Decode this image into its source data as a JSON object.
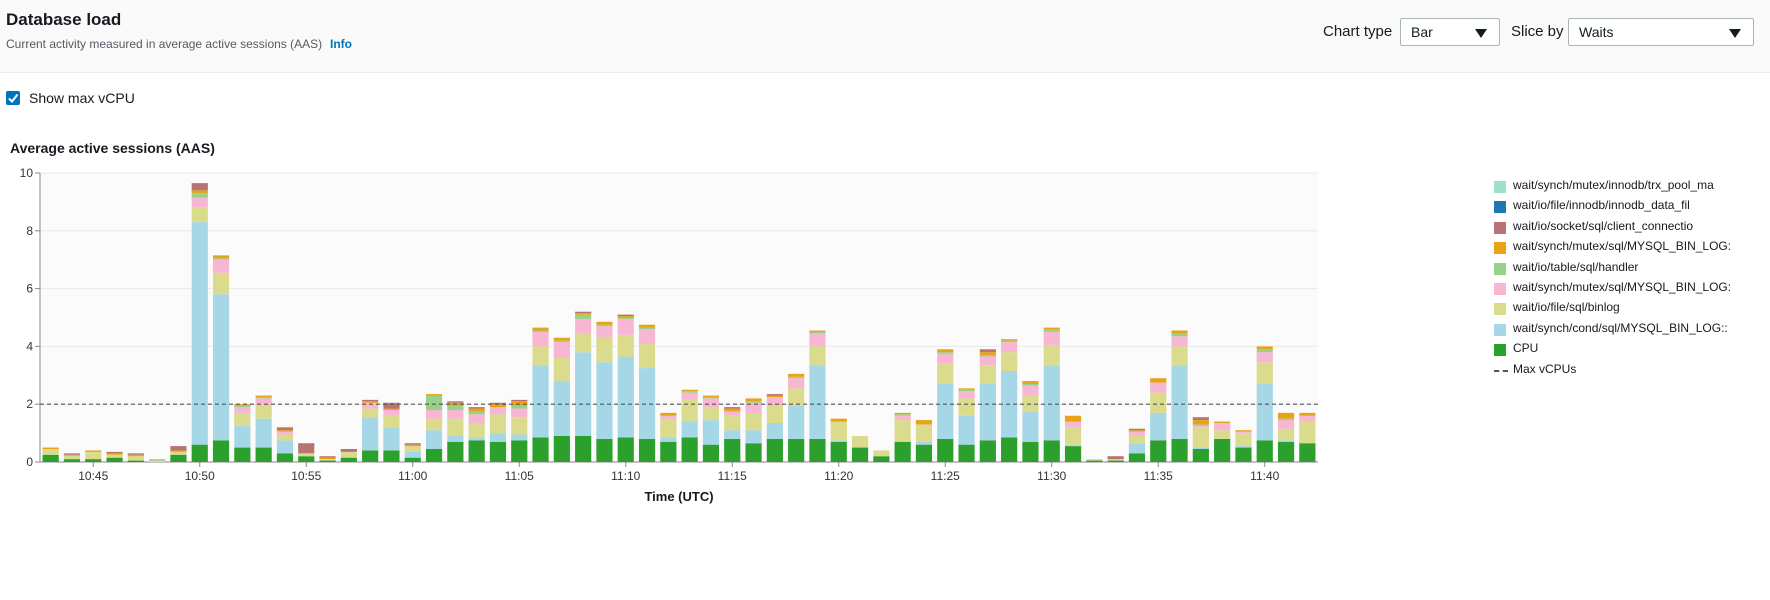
{
  "header": {
    "title": "Database load",
    "subtitle": "Current activity measured in average active sessions (AAS)",
    "info_link": "Info",
    "chart_type_label": "Chart type",
    "chart_type_value": "Bar",
    "slice_by_label": "Slice by",
    "slice_by_value": "Waits"
  },
  "controls": {
    "show_max_vcpu_label": "Show max vCPU",
    "show_max_vcpu_checked": true
  },
  "colors": {
    "accent": "#0073bb",
    "max_line": "#555555"
  },
  "chart_data": {
    "type": "bar",
    "stacked": true,
    "title": "Average active sessions (AAS)",
    "xlabel": "Time (UTC)",
    "ylabel": "",
    "ylim": [
      0,
      10
    ],
    "yticks": [
      0,
      2,
      4,
      6,
      8,
      10
    ],
    "grid": true,
    "legend_position": "right",
    "x_tick_labels": [
      "10:45",
      "10:50",
      "10:55",
      "11:00",
      "11:05",
      "11:10",
      "11:15",
      "11:20",
      "11:25",
      "11:30",
      "11:35",
      "11:40"
    ],
    "x_tick_bar_index": [
      2,
      7,
      12,
      17,
      22,
      27,
      32,
      37,
      42,
      47,
      52,
      57
    ],
    "max_vcpu": 2,
    "series": [
      {
        "name": "CPU",
        "color": "#2ca02c",
        "values": [
          0.25,
          0.1,
          0.1,
          0.15,
          0.05,
          0,
          0.25,
          0.6,
          0.75,
          0.5,
          0.5,
          0.3,
          0.2,
          0.05,
          0.15,
          0.4,
          0.4,
          0.15,
          0.45,
          0.7,
          0.75,
          0.7,
          0.75,
          0.85,
          0.9,
          0.9,
          0.8,
          0.85,
          0.8,
          0.7,
          0.85,
          0.6,
          0.8,
          0.65,
          0.8,
          0.8,
          0.8,
          0.7,
          0.5,
          0.2,
          0.7,
          0.6,
          0.8,
          0.6,
          0.75,
          0.85,
          0.7,
          0.75,
          0.55,
          0.05,
          0.05,
          0.3,
          0.75,
          0.8,
          0.45,
          0.8,
          0.5,
          0.75,
          0.7,
          0.65
        ]
      },
      {
        "name": "wait/synch/cond/sql/MYSQL_BIN_LOG::",
        "color": "#a6d7e6",
        "values": [
          0,
          0,
          0,
          0,
          0,
          0,
          0,
          7.7,
          5.05,
          0.75,
          1.0,
          0.45,
          0,
          0,
          0,
          1.15,
          0.8,
          0.2,
          0.65,
          0.2,
          0.1,
          0.3,
          0.2,
          2.5,
          1.9,
          2.9,
          2.65,
          2.8,
          2.45,
          0.15,
          0.55,
          0.85,
          0.3,
          0.45,
          0.55,
          1.15,
          2.55,
          0.05,
          0,
          0,
          0,
          0.1,
          1.9,
          1.0,
          1.95,
          2.3,
          1.05,
          2.6,
          0.05,
          0,
          0,
          0.35,
          0.95,
          2.55,
          0.05,
          0,
          0.05,
          1.95,
          0.05,
          0
        ]
      },
      {
        "name": "wait/io/file/sql/binlog",
        "color": "#dbdb8d",
        "values": [
          0.2,
          0.1,
          0.25,
          0.1,
          0.15,
          0.05,
          0.1,
          0.5,
          0.75,
          0.45,
          0.45,
          0.2,
          0.1,
          0.05,
          0.2,
          0.3,
          0.4,
          0.2,
          0.4,
          0.6,
          0.5,
          0.65,
          0.6,
          0.65,
          0.8,
          0.65,
          0.85,
          0.75,
          0.85,
          0.65,
          0.75,
          0.45,
          0.5,
          0.6,
          0.6,
          0.6,
          0.65,
          0.65,
          0.4,
          0.2,
          0.75,
          0.6,
          0.7,
          0.6,
          0.65,
          0.65,
          0.55,
          0.7,
          0.6,
          0.05,
          0.05,
          0.25,
          0.7,
          0.65,
          0.7,
          0.3,
          0.45,
          0.75,
          0.4,
          0.75
        ]
      },
      {
        "name": "wait/synch/mutex/sql/MYSQL_BIN_LOG:",
        "color": "#f7b6d2",
        "values": [
          0,
          0,
          0,
          0,
          0,
          0,
          0,
          0.35,
          0.45,
          0.2,
          0.25,
          0.1,
          0,
          0,
          0,
          0.2,
          0.2,
          0,
          0.3,
          0.3,
          0.3,
          0.25,
          0.3,
          0.5,
          0.55,
          0.5,
          0.4,
          0.55,
          0.5,
          0.1,
          0.25,
          0.3,
          0.15,
          0.35,
          0.3,
          0.35,
          0.45,
          0,
          0,
          0,
          0.15,
          0,
          0.35,
          0.25,
          0.3,
          0.35,
          0.35,
          0.45,
          0.2,
          0,
          0,
          0.15,
          0.35,
          0.35,
          0.05,
          0.25,
          0.05,
          0.35,
          0.3,
          0.2
        ]
      },
      {
        "name": "wait/io/table/sql/handler",
        "color": "#98d18a",
        "values": [
          0,
          0.05,
          0,
          0,
          0,
          0.05,
          0,
          0.15,
          0.05,
          0.05,
          0.05,
          0,
          0,
          0,
          0,
          0,
          0,
          0,
          0.5,
          0.15,
          0.1,
          0,
          0.1,
          0.05,
          0.05,
          0.15,
          0.05,
          0.05,
          0.05,
          0,
          0.05,
          0.05,
          0,
          0.05,
          0,
          0.05,
          0.05,
          0,
          0,
          0,
          0.05,
          0,
          0.05,
          0.05,
          0.05,
          0.05,
          0.05,
          0.1,
          0,
          0,
          0,
          0,
          0,
          0.1,
          0.05,
          0,
          0,
          0.1,
          0.05,
          0
        ]
      },
      {
        "name": "wait/synch/mutex/sql/MYSQL_BIN_LOG:",
        "color": "#e8a317",
        "values": [
          0.05,
          0,
          0.05,
          0.05,
          0.05,
          0,
          0.05,
          0.1,
          0.1,
          0.05,
          0.05,
          0.05,
          0,
          0.05,
          0,
          0.05,
          0.05,
          0.05,
          0.05,
          0.1,
          0.1,
          0.1,
          0.15,
          0.1,
          0.1,
          0.05,
          0.1,
          0.05,
          0.1,
          0.1,
          0.05,
          0.05,
          0.1,
          0.1,
          0.05,
          0.1,
          0.05,
          0.1,
          0,
          0,
          0.05,
          0.15,
          0.1,
          0.05,
          0.1,
          0.05,
          0.1,
          0.05,
          0.2,
          0,
          0,
          0.05,
          0.15,
          0.1,
          0.15,
          0.05,
          0.05,
          0.1,
          0.2,
          0.1
        ]
      },
      {
        "name": "wait/io/socket/sql/client_connectio",
        "color": "#b87373",
        "values": [
          0,
          0.05,
          0,
          0.05,
          0.05,
          0,
          0.15,
          0.25,
          0,
          0,
          0,
          0.1,
          0.35,
          0.05,
          0.1,
          0.05,
          0.2,
          0.05,
          0,
          0.05,
          0.05,
          0.05,
          0.05,
          0,
          0,
          0.05,
          0,
          0.05,
          0,
          0,
          0,
          0,
          0.05,
          0,
          0.05,
          0,
          0,
          0,
          0,
          0,
          0,
          0,
          0,
          0,
          0.1,
          0,
          0,
          0,
          0,
          0,
          0.1,
          0.05,
          0,
          0,
          0.1,
          0,
          0,
          0,
          0,
          0
        ]
      },
      {
        "name": "wait/io/file/innodb/innodb_data_fil",
        "color": "#1f77b4",
        "values": [
          0,
          0,
          0,
          0,
          0,
          0,
          0,
          0,
          0,
          0,
          0,
          0,
          0,
          0,
          0,
          0,
          0,
          0,
          0,
          0,
          0,
          0,
          0,
          0,
          0,
          0,
          0,
          0,
          0,
          0,
          0,
          0,
          0,
          0,
          0,
          0,
          0,
          0,
          0,
          0,
          0,
          0,
          0,
          0,
          0,
          0,
          0,
          0,
          0,
          0,
          0,
          0,
          0,
          0,
          0,
          0,
          0,
          0,
          0,
          0
        ]
      },
      {
        "name": "wait/synch/mutex/innodb/trx_pool_ma",
        "color": "#9edfc8",
        "values": [
          0,
          0,
          0,
          0,
          0,
          0,
          0,
          0,
          0,
          0,
          0,
          0,
          0,
          0,
          0,
          0,
          0,
          0,
          0,
          0,
          0,
          0,
          0,
          0,
          0,
          0,
          0,
          0,
          0,
          0,
          0,
          0,
          0,
          0,
          0,
          0,
          0,
          0,
          0,
          0,
          0,
          0,
          0,
          0,
          0,
          0,
          0,
          0,
          0,
          0,
          0,
          0,
          0,
          0,
          0,
          0,
          0,
          0,
          0,
          0
        ]
      }
    ],
    "legend": [
      {
        "label": "wait/synch/mutex/innodb/trx_pool_ma",
        "color": "#9edfc8"
      },
      {
        "label": "wait/io/file/innodb/innodb_data_fil",
        "color": "#1f77b4"
      },
      {
        "label": "wait/io/socket/sql/client_connectio",
        "color": "#b87373"
      },
      {
        "label": "wait/synch/mutex/sql/MYSQL_BIN_LOG:",
        "color": "#e8a317"
      },
      {
        "label": "wait/io/table/sql/handler",
        "color": "#98d18a"
      },
      {
        "label": "wait/synch/mutex/sql/MYSQL_BIN_LOG:",
        "color": "#f7b6d2"
      },
      {
        "label": "wait/io/file/sql/binlog",
        "color": "#dbdb8d"
      },
      {
        "label": "wait/synch/cond/sql/MYSQL_BIN_LOG::",
        "color": "#a6d7e6"
      },
      {
        "label": "CPU",
        "color": "#2ca02c"
      },
      {
        "label": "Max vCPUs",
        "color": "#555555",
        "dashed": true
      }
    ]
  }
}
